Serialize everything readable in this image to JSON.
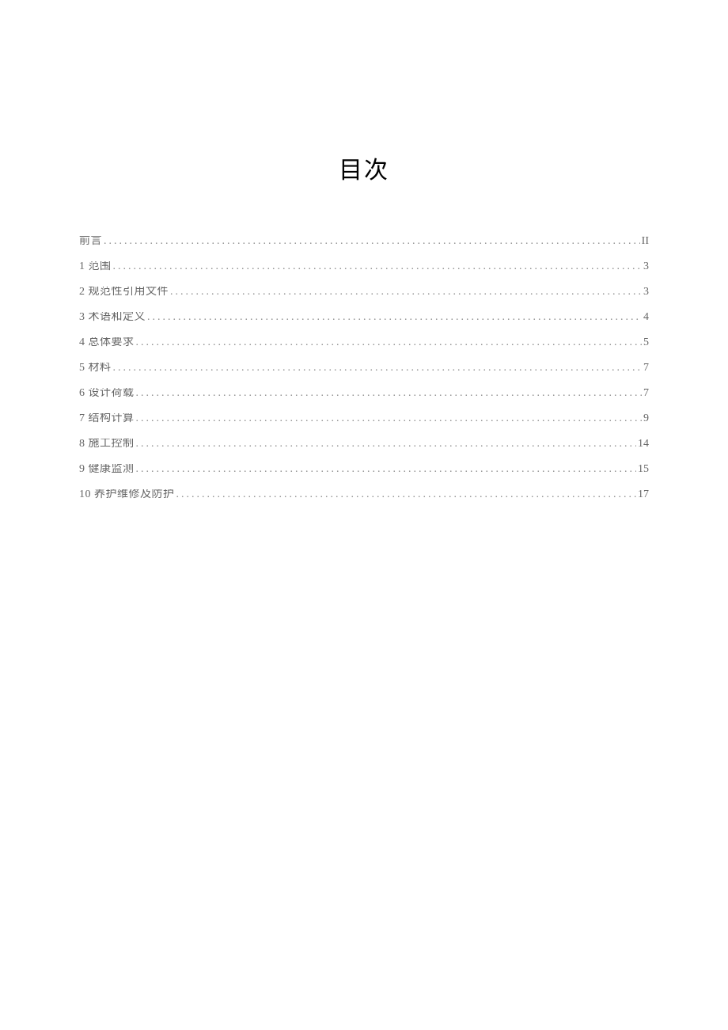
{
  "title": "目次",
  "toc": [
    {
      "label": "前言",
      "page": "II"
    },
    {
      "label": "1 范围",
      "page": "3"
    },
    {
      "label": "2 规范性引用文件",
      "page": "3"
    },
    {
      "label": "3 术语和定义",
      "page": "4"
    },
    {
      "label": "4 总体要求",
      "page": "5"
    },
    {
      "label": "5 材料",
      "page": "7"
    },
    {
      "label": "6 设计荷载",
      "page": "7"
    },
    {
      "label": "7 结构计算",
      "page": "9"
    },
    {
      "label": "8 施工控制",
      "page": "14"
    },
    {
      "label": "9 健康监测",
      "page": "15"
    },
    {
      "label": "10 养护维修及防护",
      "page": "17"
    }
  ]
}
